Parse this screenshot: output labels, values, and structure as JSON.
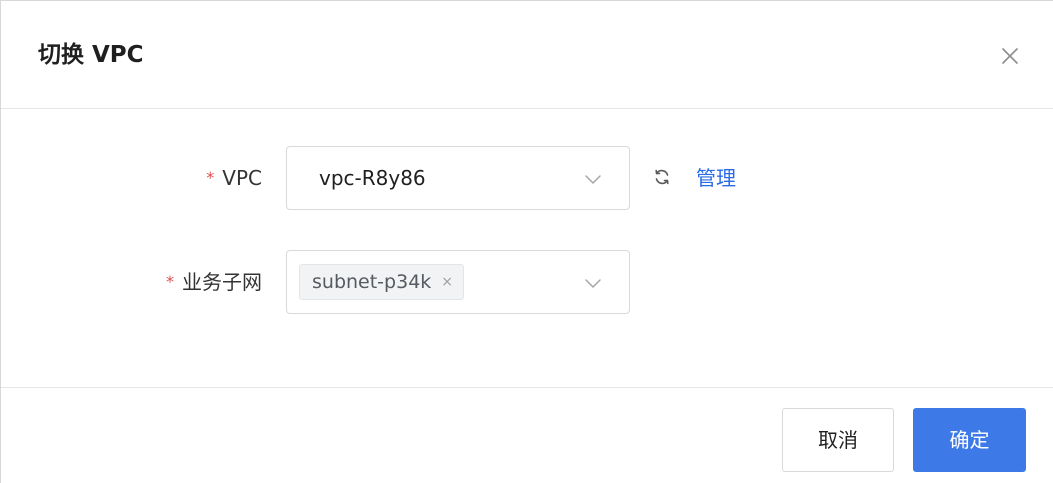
{
  "dialog": {
    "title": "切换 VPC",
    "close_icon": "close-icon"
  },
  "form": {
    "vpc": {
      "required_mark": "*",
      "label": "VPC",
      "value": "vpc-R8y86",
      "dropdown_icon": "chevron-down-icon",
      "refresh_icon": "refresh-icon",
      "manage_link": "管理"
    },
    "subnet": {
      "required_mark": "*",
      "label": "业务子网",
      "tags": [
        {
          "label": "subnet-p34k",
          "remove_symbol": "×"
        }
      ],
      "dropdown_icon": "chevron-down-icon"
    }
  },
  "footer": {
    "cancel_label": "取消",
    "confirm_label": "确定"
  },
  "colors": {
    "required": "#e34d4d",
    "link": "#2a6ce6",
    "primary_button": "#3d7ae8",
    "border": "#d9d9d9"
  }
}
